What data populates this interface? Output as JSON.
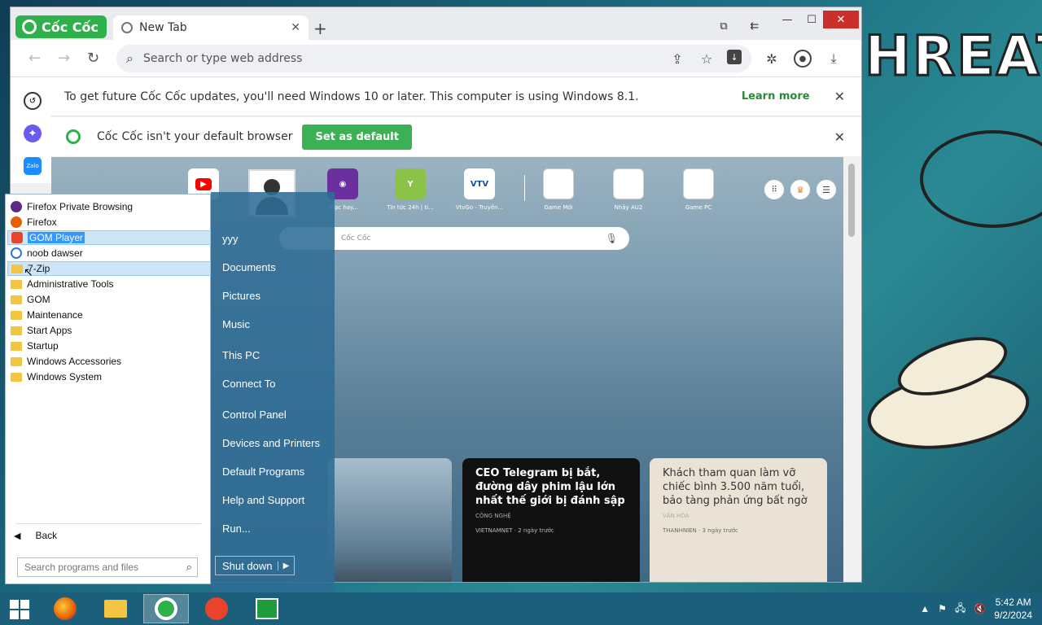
{
  "browser": {
    "brand": "Cốc Cốc",
    "tab_title": "New Tab",
    "address_placeholder": "Search or type web address",
    "update_notice": "To get future Cốc Cốc updates, you'll need Windows 10 or later. This computer is using Windows 8.1.",
    "learn_more": "Learn more",
    "default_notice": "Cốc Cốc isn't your default browser",
    "set_default": "Set as default",
    "new_tab_search_placeholder": "Cốc Cốc",
    "sites": [
      {
        "label": "",
        "icon": "youtube-icon"
      },
      {
        "label": "",
        "icon": "user-icon"
      },
      {
        "label": "nhạc hay...",
        "icon": "music-icon"
      },
      {
        "label": "Tin tức 24h | ti...",
        "icon": "news-icon"
      },
      {
        "label": "VtvGo - Truyền...",
        "icon": "vtv-icon"
      },
      {
        "label": "Game Mới",
        "icon": "blank-icon"
      },
      {
        "label": "Nhảy AU2",
        "icon": "blank-icon"
      },
      {
        "label": "Game PC",
        "icon": "blank-icon"
      }
    ],
    "site_vtv_text": "VTV",
    "news": [
      {
        "title": "CEO Telegram bị bắt, đường dây phim lậu lớn nhất thế giới bị đánh sập",
        "category": "CÔNG NGHỆ",
        "source": "VIETNAMNET · 2 ngày trước"
      },
      {
        "title": "Khách tham quan làm vỡ chiếc bình 3.500 năm tuổi, bảo tàng phản ứng bất ngờ",
        "category": "VĂN HÓA",
        "source": "THANHNIEN · 3 ngày trước"
      }
    ]
  },
  "start_menu": {
    "programs": [
      {
        "label": "Firefox Private Browsing",
        "icon": "firefox-private-icon"
      },
      {
        "label": "Firefox",
        "icon": "firefox-icon"
      },
      {
        "label": "GOM Player",
        "icon": "gom-player-icon"
      },
      {
        "label": "noob dawser",
        "icon": "ie-icon"
      },
      {
        "label": "7-Zip",
        "icon": "folder-icon"
      },
      {
        "label": "Administrative Tools",
        "icon": "folder-icon"
      },
      {
        "label": "GOM",
        "icon": "folder-icon"
      },
      {
        "label": "Maintenance",
        "icon": "folder-icon"
      },
      {
        "label": "Start Apps",
        "icon": "folder-icon"
      },
      {
        "label": "Startup",
        "icon": "folder-icon"
      },
      {
        "label": "Windows Accessories",
        "icon": "folder-icon"
      },
      {
        "label": "Windows System",
        "icon": "folder-icon"
      }
    ],
    "back_label": "Back",
    "search_placeholder": "Search programs and files",
    "right_links": [
      "yyy",
      "Documents",
      "Pictures",
      "Music",
      "This PC",
      "Connect To",
      "Control Panel",
      "Devices and Printers",
      "Default Programs",
      "Help and Support",
      "Run..."
    ],
    "shutdown_label": "Shut down"
  },
  "taskbar": {
    "apps": [
      "firefox-icon",
      "file-explorer-icon",
      "coccoc-icon",
      "gom-player-icon",
      "store-icon"
    ],
    "time": "5:42 AM",
    "date": "9/2/2024"
  },
  "desktop": {
    "wallpaper_text": "HREAT"
  }
}
